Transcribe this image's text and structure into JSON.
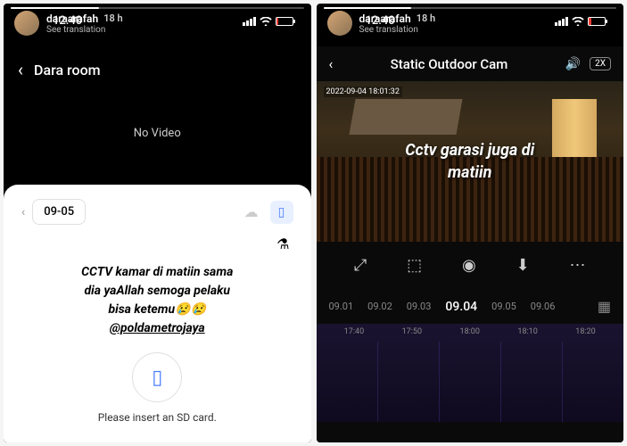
{
  "left": {
    "username": "daraarafah",
    "time_ago": "18 h",
    "see_translation": "See translation",
    "status_time": "12.40",
    "app_title": "Dara room",
    "no_video": "No Video",
    "date_label": "09-05",
    "overlay_line1": "CCTV kamar di matiin sama",
    "overlay_line2": "dia yaAllah semoga pelaku",
    "overlay_line3": "bisa ketemu😢😢",
    "mention": "@poldametrojaya",
    "sd_message": "Please insert an SD card."
  },
  "right": {
    "username": "daraarafah",
    "time_ago": "18 h",
    "see_translation": "See translation",
    "status_time": "12.40",
    "cam_title": "Static Outdoor Cam",
    "speed": "2X",
    "timestamp": "2022-09-04 18:01:32",
    "overlay_line1": "Cctv garasi juga di",
    "overlay_line2": "matiin",
    "dates": [
      "09.01",
      "09.02",
      "09.03",
      "09.04",
      "09.05",
      "09.06"
    ],
    "active_date_index": 3,
    "timeline_labels": [
      "17:40",
      "17:50",
      "18:00",
      "18:10",
      "18:20"
    ]
  }
}
